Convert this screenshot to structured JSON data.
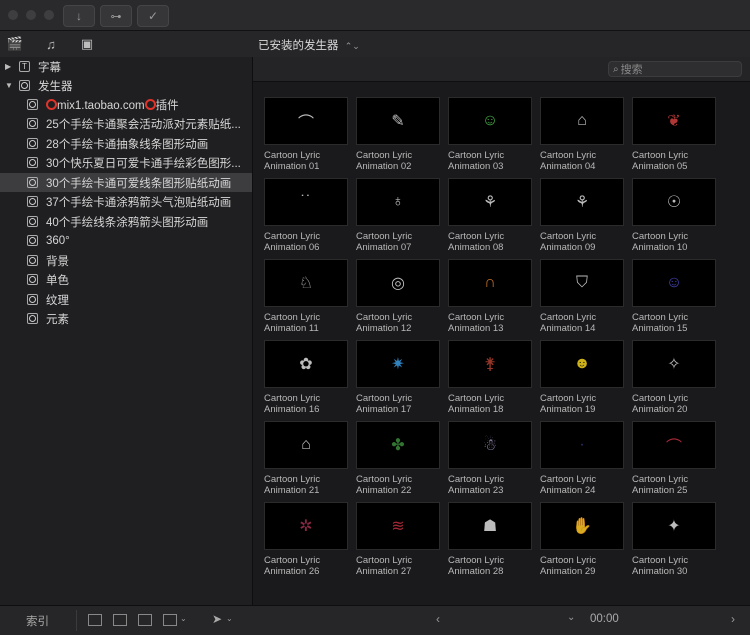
{
  "titlebar": {
    "download_icon": "down-arrow-icon",
    "key_icon": "key-icon",
    "check_icon": "check-circle-icon"
  },
  "toolbar": {
    "title": "已安装的发生器"
  },
  "search": {
    "placeholder": "搜索"
  },
  "sidebar": {
    "items": [
      {
        "label": "字幕"
      },
      {
        "label": "发生器"
      },
      {
        "label": "mix1.taobao.com"
      },
      {
        "label": "插件"
      },
      {
        "label": "25个手绘卡通聚会活动派对元素贴纸..."
      },
      {
        "label": "28个手绘卡通抽象线条图形动画"
      },
      {
        "label": "30个快乐夏日可爱卡通手绘彩色图形..."
      },
      {
        "label": "30个手绘卡通可爱线条图形贴纸动画"
      },
      {
        "label": "37个手绘卡通涂鸦箭头气泡贴纸动画"
      },
      {
        "label": "40个手绘线条涂鸦箭头图形动画"
      },
      {
        "label": "360°"
      },
      {
        "label": "背景"
      },
      {
        "label": "单色"
      },
      {
        "label": "纹理"
      },
      {
        "label": "元素"
      }
    ]
  },
  "tiles": [
    {
      "l1": "Cartoon Lyric",
      "l2": "Animation 01",
      "color": "#dddddd"
    },
    {
      "l1": "Cartoon Lyric",
      "l2": "Animation 02",
      "color": "#dddddd"
    },
    {
      "l1": "Cartoon Lyric",
      "l2": "Animation 03",
      "color": "#4fcf4f"
    },
    {
      "l1": "Cartoon Lyric",
      "l2": "Animation 04",
      "color": "#dddddd"
    },
    {
      "l1": "Cartoon Lyric",
      "l2": "Animation 05",
      "color": "#d04040"
    },
    {
      "l1": "Cartoon Lyric",
      "l2": "Animation 06",
      "color": "#dddddd"
    },
    {
      "l1": "Cartoon Lyric",
      "l2": "Animation 07",
      "color": "#dddddd"
    },
    {
      "l1": "Cartoon Lyric",
      "l2": "Animation 08",
      "color": "#dddddd"
    },
    {
      "l1": "Cartoon Lyric",
      "l2": "Animation 09",
      "color": "#dddddd"
    },
    {
      "l1": "Cartoon Lyric",
      "l2": "Animation 10",
      "color": "#dddddd"
    },
    {
      "l1": "Cartoon Lyric",
      "l2": "Animation 11",
      "color": "#dddddd"
    },
    {
      "l1": "Cartoon Lyric",
      "l2": "Animation 12",
      "color": "#dddddd"
    },
    {
      "l1": "Cartoon Lyric",
      "l2": "Animation 13",
      "color": "#e08030"
    },
    {
      "l1": "Cartoon Lyric",
      "l2": "Animation 14",
      "color": "#dddddd"
    },
    {
      "l1": "Cartoon Lyric",
      "l2": "Animation 15",
      "color": "#5050d0"
    },
    {
      "l1": "Cartoon Lyric",
      "l2": "Animation 16",
      "color": "#dddddd"
    },
    {
      "l1": "Cartoon Lyric",
      "l2": "Animation 17",
      "color": "#3a9ae0"
    },
    {
      "l1": "Cartoon Lyric",
      "l2": "Animation 18",
      "color": "#b04030"
    },
    {
      "l1": "Cartoon Lyric",
      "l2": "Animation 19",
      "color": "#f0d020"
    },
    {
      "l1": "Cartoon Lyric",
      "l2": "Animation 20",
      "color": "#dddddd"
    },
    {
      "l1": "Cartoon Lyric",
      "l2": "Animation 21",
      "color": "#dddddd"
    },
    {
      "l1": "Cartoon Lyric",
      "l2": "Animation 22",
      "color": "#3a8a3a"
    },
    {
      "l1": "Cartoon Lyric",
      "l2": "Animation 23",
      "color": "#c0b0e0"
    },
    {
      "l1": "Cartoon Lyric",
      "l2": "Animation 24",
      "color": "#3a3a7a"
    },
    {
      "l1": "Cartoon Lyric",
      "l2": "Animation 25",
      "color": "#c03040"
    },
    {
      "l1": "Cartoon Lyric",
      "l2": "Animation 26",
      "color": "#a03050"
    },
    {
      "l1": "Cartoon Lyric",
      "l2": "Animation 27",
      "color": "#c03040"
    },
    {
      "l1": "Cartoon Lyric",
      "l2": "Animation 28",
      "color": "#dddddd"
    },
    {
      "l1": "Cartoon Lyric",
      "l2": "Animation 29",
      "color": "#dddddd"
    },
    {
      "l1": "Cartoon Lyric",
      "l2": "Animation 30",
      "color": "#dddddd"
    }
  ],
  "bottombar": {
    "index_label": "索引",
    "timecode": "00:00"
  }
}
